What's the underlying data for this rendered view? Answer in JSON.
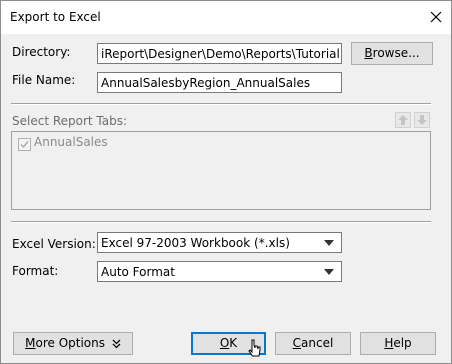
{
  "window": {
    "title": "Export to Excel"
  },
  "directory": {
    "label": "Directory:",
    "value": "iReport\\Designer\\Demo\\Reports\\TutorialReports\\",
    "browse_pre": "",
    "browse_u": "B",
    "browse_post": "rowse..."
  },
  "file_name": {
    "label": "File Name:",
    "value": "AnnualSalesbyRegion_AnnualSales"
  },
  "report_tabs": {
    "label": "Select Report Tabs:",
    "items": [
      {
        "label": "AnnualSales",
        "checked": true,
        "disabled": true
      }
    ]
  },
  "excel_version": {
    "label": "Excel Version:",
    "value": "Excel 97-2003 Workbook (*.xls)"
  },
  "format": {
    "label": "Format:",
    "value": "Auto Format"
  },
  "buttons": {
    "more_options_pre": "",
    "more_options_u": "M",
    "more_options_post": "ore Options",
    "ok_pre": "",
    "ok_u": "O",
    "ok_post": "K",
    "cancel_pre": "",
    "cancel_u": "C",
    "cancel_post": "ancel",
    "help_pre": "",
    "help_u": "H",
    "help_post": "elp"
  },
  "colors": {
    "accent": "#0078d7",
    "dialog_bg": "#f0f0f0"
  },
  "icons": [
    "close-icon",
    "arrow-up-icon",
    "arrow-down-icon",
    "double-chevron-down-icon",
    "mouse-cursor-icon",
    "dropdown-arrow-icon"
  ]
}
